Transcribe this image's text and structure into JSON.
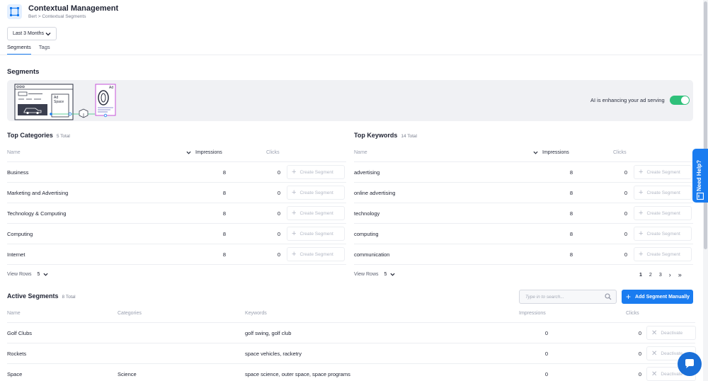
{
  "app": {
    "title": "Contextual Management",
    "breadcrumb": "Bert > Contextual Segments",
    "accent_color": "#1a7cf0"
  },
  "range_select": {
    "value": "Last 3 Months",
    "icon": "chevron-down-icon"
  },
  "tabs": [
    {
      "label": "Segments",
      "active": true
    },
    {
      "label": "Tags",
      "active": false
    }
  ],
  "segments_section": {
    "title": "Segments",
    "banner_labels": {
      "ad_space": "Ad\nSpace",
      "ad": "Ad"
    },
    "ai_label": "AI is enhancing your ad serving",
    "ai_toggle_on": true,
    "toggle_color": "#2fc07a"
  },
  "top_categories": {
    "title": "Top Categories",
    "count": "5 Total",
    "columns": {
      "name": "Name",
      "impressions": "Impressions",
      "clicks": "Clicks"
    },
    "rows": [
      {
        "name": "Business",
        "impressions": "8",
        "clicks": "0",
        "action": "Create Segment"
      },
      {
        "name": "Marketing and Advertising",
        "impressions": "8",
        "clicks": "0",
        "action": "Create Segment"
      },
      {
        "name": "Technology & Computing",
        "impressions": "8",
        "clicks": "0",
        "action": "Create Segment"
      },
      {
        "name": "Computing",
        "impressions": "8",
        "clicks": "0",
        "action": "Create Segment"
      },
      {
        "name": "Internet",
        "impressions": "8",
        "clicks": "0",
        "action": "Create Segment"
      }
    ],
    "view_rows_label": "View Rows",
    "view_rows_value": "5"
  },
  "top_keywords": {
    "title": "Top Keywords",
    "count": "14 Total",
    "columns": {
      "name": "Name",
      "impressions": "Impressions",
      "clicks": "Clicks"
    },
    "rows": [
      {
        "name": "advertising",
        "impressions": "8",
        "clicks": "0",
        "action": "Create Segment"
      },
      {
        "name": "online advertising",
        "impressions": "8",
        "clicks": "0",
        "action": "Create Segment"
      },
      {
        "name": "technology",
        "impressions": "8",
        "clicks": "0",
        "action": "Create Segment"
      },
      {
        "name": "computing",
        "impressions": "8",
        "clicks": "0",
        "action": "Create Segment"
      },
      {
        "name": "communication",
        "impressions": "8",
        "clicks": "0",
        "action": "Create Segment"
      }
    ],
    "view_rows_label": "View Rows",
    "view_rows_value": "5",
    "pagination": {
      "pages": [
        "1",
        "2",
        "3"
      ],
      "current": "1",
      "next": "›",
      "last": "»"
    }
  },
  "active_segments": {
    "title": "Active Segments",
    "count": "8 Total",
    "search_placeholder": "Type in to search...",
    "add_button": "Add Segment Manually",
    "columns": {
      "name": "Name",
      "categories": "Categories",
      "keywords": "Keywords",
      "impressions": "Impressions",
      "clicks": "Clicks"
    },
    "rows": [
      {
        "name": "Golf Clubs",
        "categories": "",
        "keywords": "golf swing, golf club",
        "impressions": "0",
        "clicks": "0",
        "action": "Deactivate"
      },
      {
        "name": "Rockets",
        "categories": "",
        "keywords": "space vehicles, racketry",
        "impressions": "0",
        "clicks": "0",
        "action": "Deactivate"
      },
      {
        "name": "Space",
        "categories": "Science",
        "keywords": "space science, outer space, space programs",
        "impressions": "0",
        "clicks": "0",
        "action": "Deactivate"
      }
    ]
  },
  "need_help": {
    "label": "Need Help?"
  }
}
